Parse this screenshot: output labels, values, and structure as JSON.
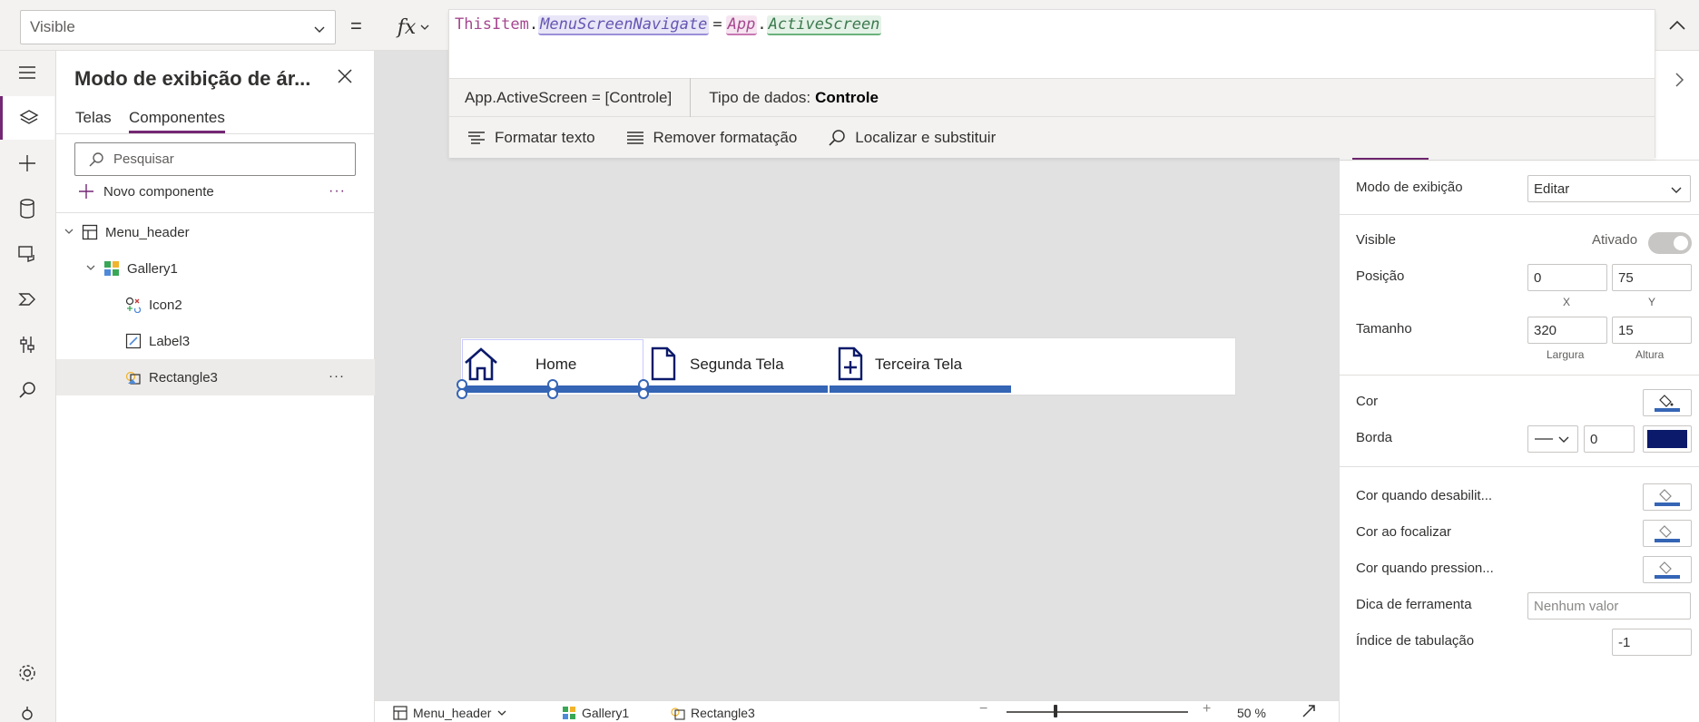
{
  "formula_bar": {
    "property": "Visible",
    "equals": "=",
    "fx_label": "fx",
    "tokens": {
      "this_item": "ThisItem",
      "dot1": ".",
      "menu_nav": "MenuScreenNavigate",
      "eq": "=",
      "app": "App",
      "dot2": ".",
      "active_screen": "ActiveScreen"
    },
    "hint_left": "App.ActiveScreen  =  [Controle]",
    "hint_type_label": "Tipo de dados:",
    "hint_type_value": "Controle",
    "format_text": "Formatar texto",
    "remove_format": "Remover formatação",
    "find_replace": "Localizar e substituir"
  },
  "tree": {
    "title": "Modo de exibição de ár...",
    "tabs": [
      "Telas",
      "Componentes"
    ],
    "search_placeholder": "Pesquisar",
    "new_component": "Novo componente",
    "more": "···",
    "items": [
      {
        "label": "Menu_header"
      },
      {
        "label": "Gallery1"
      },
      {
        "label": "Icon2"
      },
      {
        "label": "Label3"
      },
      {
        "label": "Rectangle3"
      }
    ]
  },
  "canvas": {
    "menu_items": [
      "Home",
      "Segunda Tela",
      "Terceira Tela"
    ]
  },
  "bottom_bar": {
    "crumbs": [
      "Menu_header",
      "Gallery1",
      "Rectangle3"
    ],
    "zoom_minus": "−",
    "zoom_plus": "+",
    "zoom": "50  %"
  },
  "properties": {
    "display_mode_label": "Modo de exibição",
    "display_mode_value": "Editar",
    "visible_label": "Visible",
    "visible_state": "Ativado",
    "position_label": "Posição",
    "x": "0",
    "y": "75",
    "x_label": "X",
    "y_label": "Y",
    "size_label": "Tamanho",
    "width": "320",
    "height": "15",
    "width_label": "Largura",
    "height_label": "Altura",
    "color_label": "Cor",
    "border_label": "Borda",
    "border_width": "0",
    "disabled_color_label": "Cor quando desabilit...",
    "hover_color_label": "Cor ao focalizar",
    "pressed_color_label": "Cor quando pression...",
    "tooltip_label": "Dica de ferramenta",
    "tooltip_placeholder": "Nenhum valor",
    "tab_index_label": "Índice de tabulação",
    "tab_index": "-1",
    "colors": {
      "fill": "#3565b5",
      "border": "#0b1a6b",
      "accent": "#742774"
    }
  }
}
